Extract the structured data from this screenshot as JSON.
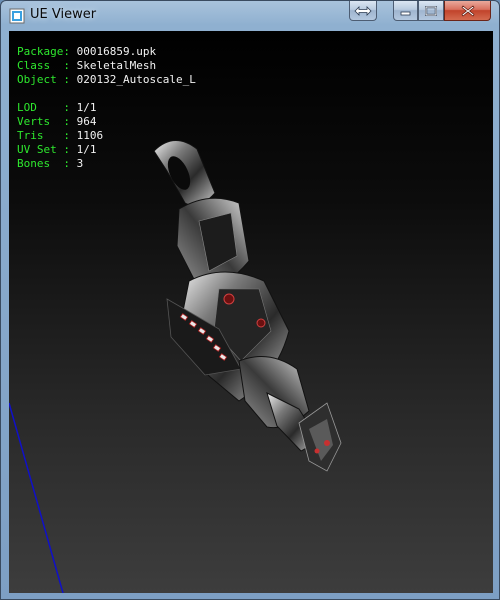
{
  "window": {
    "title": "UE Viewer"
  },
  "titlebar": {
    "restore_icon": "double-arrow-icon",
    "minimize_icon": "minimize-icon",
    "maximize_icon": "maximize-icon",
    "close_icon": "close-icon"
  },
  "info": {
    "package": {
      "key": "Package:",
      "value": "00016859.upk"
    },
    "class": {
      "key": "Class  :",
      "value": "SkeletalMesh"
    },
    "object": {
      "key": "Object :",
      "value": "020132_Autoscale_L"
    },
    "lod": {
      "key": "LOD    :",
      "value": "1/1"
    },
    "verts": {
      "key": "Verts  :",
      "value": "964"
    },
    "tris": {
      "key": "Tris   :",
      "value": "1106"
    },
    "uvset": {
      "key": "UV Set :",
      "value": "1/1"
    },
    "bones": {
      "key": "Bones  :",
      "value": "3"
    }
  },
  "colors": {
    "label": "#2ee82e",
    "value": "#f2f2f2",
    "axis_line": "#1010c8"
  }
}
